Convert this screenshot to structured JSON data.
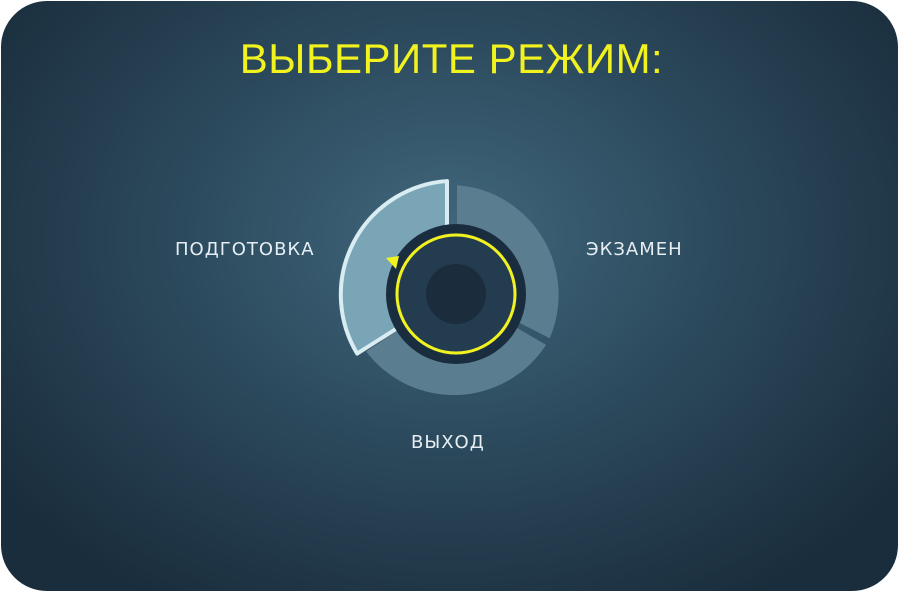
{
  "title": "ВЫБЕРИТЕ РЕЖИМ:",
  "modes": [
    {
      "id": "prep",
      "label": "ПОДГОТОВКА",
      "selected": true
    },
    {
      "id": "exam",
      "label": "ЭКЗАМЕН",
      "selected": false
    },
    {
      "id": "exit",
      "label": "ВЫХОД",
      "selected": false
    }
  ],
  "colors": {
    "title": "#f2f21e",
    "label": "#e6eef3",
    "ring_indicator": "#f2f21e",
    "segment_idle": "#5b7d90",
    "segment_selected": "#7aa5b6",
    "segment_selected_border": "#d8ecf2",
    "knob_outer": "#1a2d3e",
    "knob_inner": "#243c50",
    "knob_center": "#1b2c3d"
  },
  "dial": {
    "icon": "rotary-selector-knob",
    "selected_mode": "ПОДГОТОВКА"
  }
}
